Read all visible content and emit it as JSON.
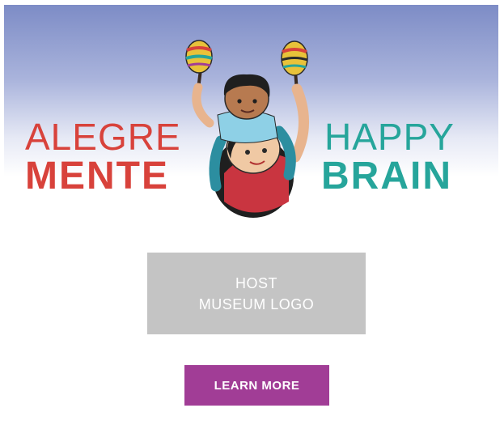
{
  "banner": {
    "spanish_line1": "ALEGRE",
    "spanish_line2": "MENTE",
    "english_line1": "HAPPY",
    "english_line2": "BRAIN",
    "illustration_icon": "child-on-shoulders-with-maracas-icon",
    "colors": {
      "spanish_text": "#d8423b",
      "english_text": "#26a59b",
      "sky_top": "#7d8cc6"
    }
  },
  "host_logo": {
    "line1": "HOST",
    "line2": "MUSEUM LOGO",
    "background": "#c4c4c4"
  },
  "cta": {
    "label": "LEARN MORE",
    "background": "#a13d96"
  }
}
